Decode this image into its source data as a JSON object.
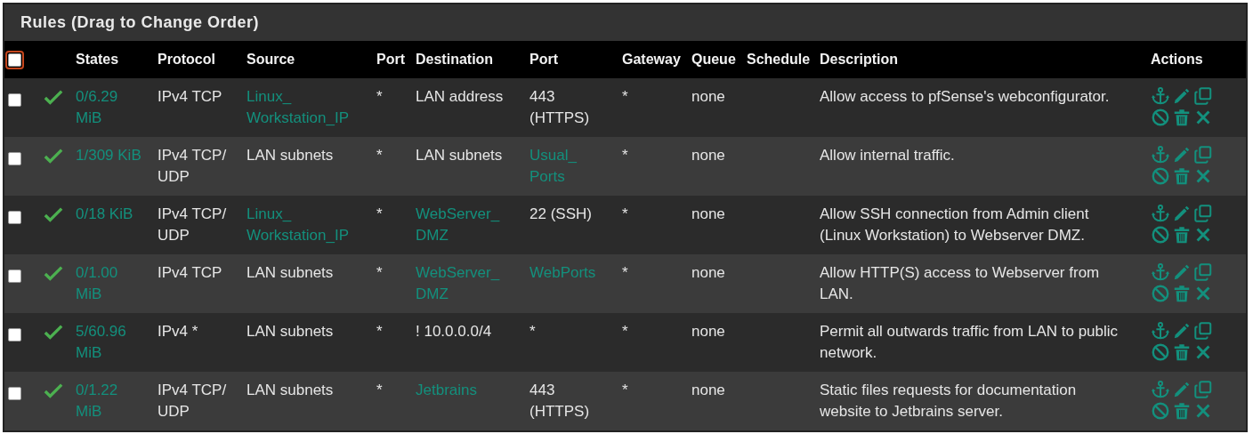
{
  "panel": {
    "title": "Rules (Drag to Change Order)"
  },
  "table": {
    "select_all": {
      "checked": false,
      "focused": true
    },
    "columns": [
      "States",
      "Protocol",
      "Source",
      "Port",
      "Destination",
      "Port",
      "Gateway",
      "Queue",
      "Schedule",
      "Description",
      "Actions"
    ],
    "rows": [
      {
        "checked": false,
        "enabled": true,
        "states": "0/6.29 MiB",
        "protocol": "IPv4 TCP",
        "source": {
          "text": "Linux_Workstation_IP",
          "link": true
        },
        "source_port": "*",
        "destination": {
          "text": "LAN address",
          "link": false
        },
        "destination_port": {
          "text": "443 (HTTPS)",
          "link": false
        },
        "gateway": "*",
        "queue": "none",
        "description": "Allow access to pfSense's webconfigurator."
      },
      {
        "checked": false,
        "enabled": true,
        "states": "1/309 KiB",
        "protocol": "IPv4 TCP/UDP",
        "source": {
          "text": "LAN subnets",
          "link": false
        },
        "source_port": "*",
        "destination": {
          "text": "LAN subnets",
          "link": false
        },
        "destination_port": {
          "text": "Usual_Ports",
          "link": true
        },
        "gateway": "*",
        "queue": "none",
        "description": "Allow internal traffic."
      },
      {
        "checked": false,
        "enabled": true,
        "states": "0/18 KiB",
        "protocol": "IPv4 TCP/UDP",
        "source": {
          "text": "Linux_Workstation_IP",
          "link": true
        },
        "source_port": "*",
        "destination": {
          "text": "WebServer_DMZ",
          "link": true
        },
        "destination_port": {
          "text": "22 (SSH)",
          "link": false
        },
        "gateway": "*",
        "queue": "none",
        "description": "Allow SSH connection from Admin client (Linux Workstation) to Webserver DMZ."
      },
      {
        "checked": false,
        "enabled": true,
        "states": "0/1.00 MiB",
        "protocol": "IPv4 TCP",
        "source": {
          "text": "LAN subnets",
          "link": false
        },
        "source_port": "*",
        "destination": {
          "text": "WebServer_DMZ",
          "link": true
        },
        "destination_port": {
          "text": "WebPorts",
          "link": true
        },
        "gateway": "*",
        "queue": "none",
        "description": "Allow HTTP(S) access to Webserver from LAN."
      },
      {
        "checked": false,
        "enabled": true,
        "states": "5/60.96 MiB",
        "protocol": "IPv4 *",
        "source": {
          "text": "LAN subnets",
          "link": false
        },
        "source_port": "*",
        "destination": {
          "text": "! 10.0.0.0/4",
          "link": false
        },
        "destination_port": {
          "text": "*",
          "link": false
        },
        "gateway": "*",
        "queue": "none",
        "description": "Permit all outwards traffic from LAN to public network."
      },
      {
        "checked": false,
        "enabled": true,
        "states": "0/1.22 MiB",
        "protocol": "IPv4 TCP/UDP",
        "source": {
          "text": "LAN subnets",
          "link": false
        },
        "source_port": "*",
        "destination": {
          "text": "Jetbrains",
          "link": true
        },
        "destination_port": {
          "text": "443 (HTTPS)",
          "link": false
        },
        "gateway": "*",
        "queue": "none",
        "description": "Static files requests for documentation website to Jetbrains server."
      }
    ]
  }
}
